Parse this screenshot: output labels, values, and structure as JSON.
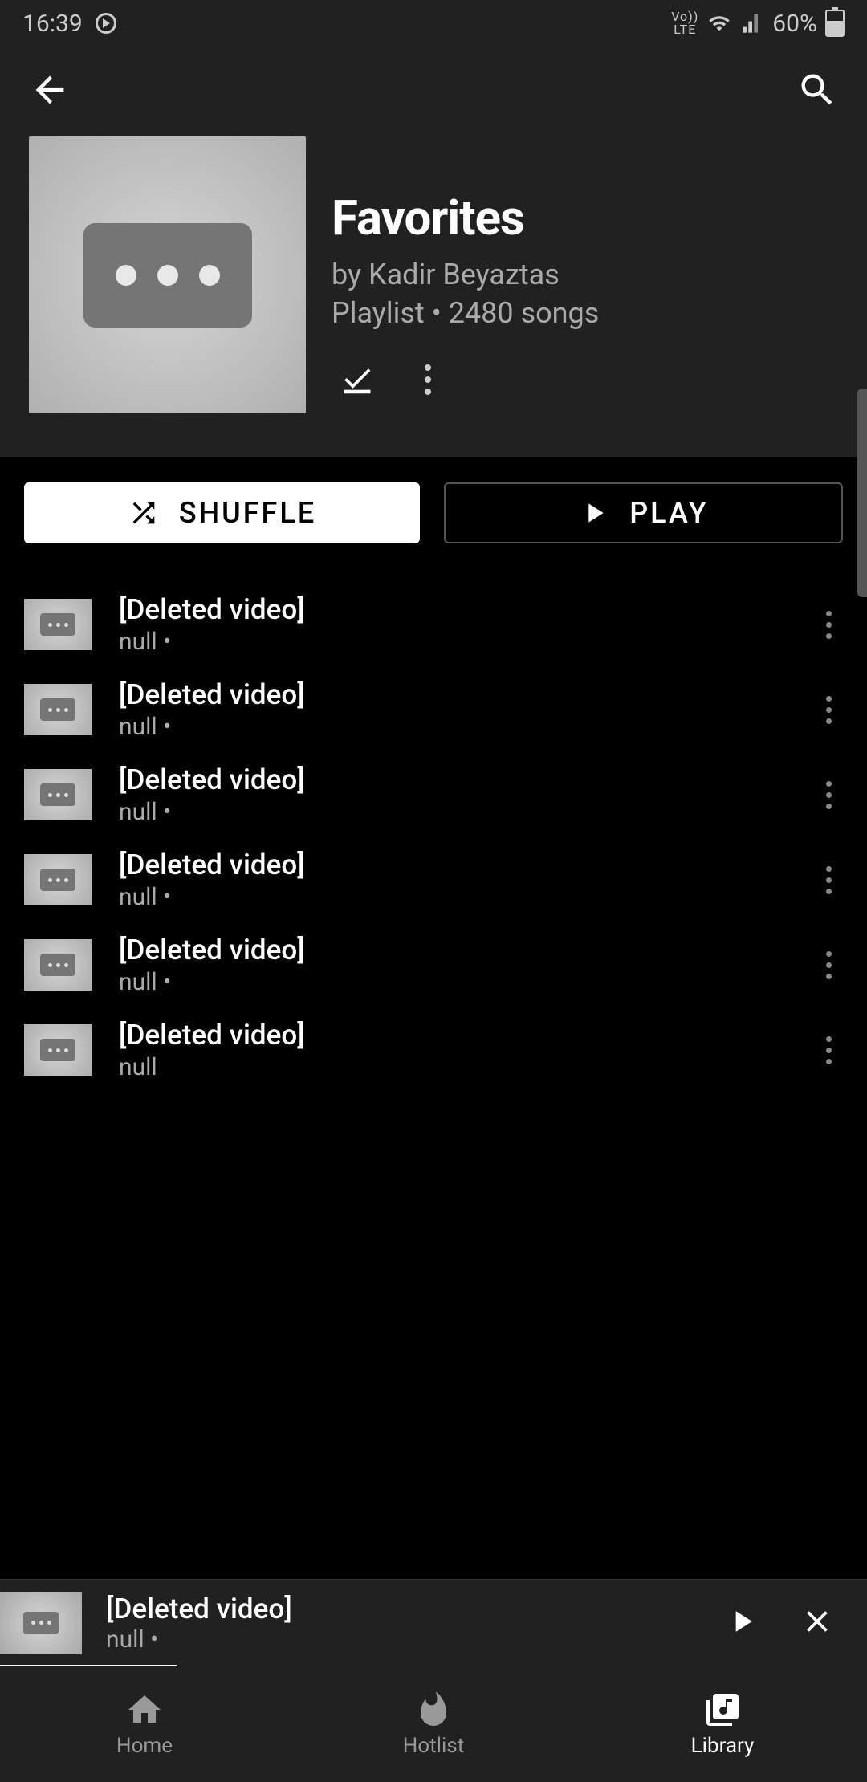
{
  "status": {
    "time": "16:39",
    "lte": "Vo))\nLTE",
    "battery_pct": "60%"
  },
  "playlist": {
    "title": "Favorites",
    "byline": "by Kadir Beyaztas",
    "type_label": "Playlist",
    "count_label": "2480 songs"
  },
  "buttons": {
    "shuffle": "SHUFFLE",
    "play": "PLAY"
  },
  "songs": [
    {
      "title": "[Deleted video]",
      "sub": "null •"
    },
    {
      "title": "[Deleted video]",
      "sub": "null •"
    },
    {
      "title": "[Deleted video]",
      "sub": "null •"
    },
    {
      "title": "[Deleted video]",
      "sub": "null •"
    },
    {
      "title": "[Deleted video]",
      "sub": "null •"
    },
    {
      "title": "[Deleted video]",
      "sub": "null"
    }
  ],
  "mini": {
    "title": "[Deleted video]",
    "sub": "null •"
  },
  "nav": {
    "home": "Home",
    "hotlist": "Hotlist",
    "library": "Library"
  }
}
